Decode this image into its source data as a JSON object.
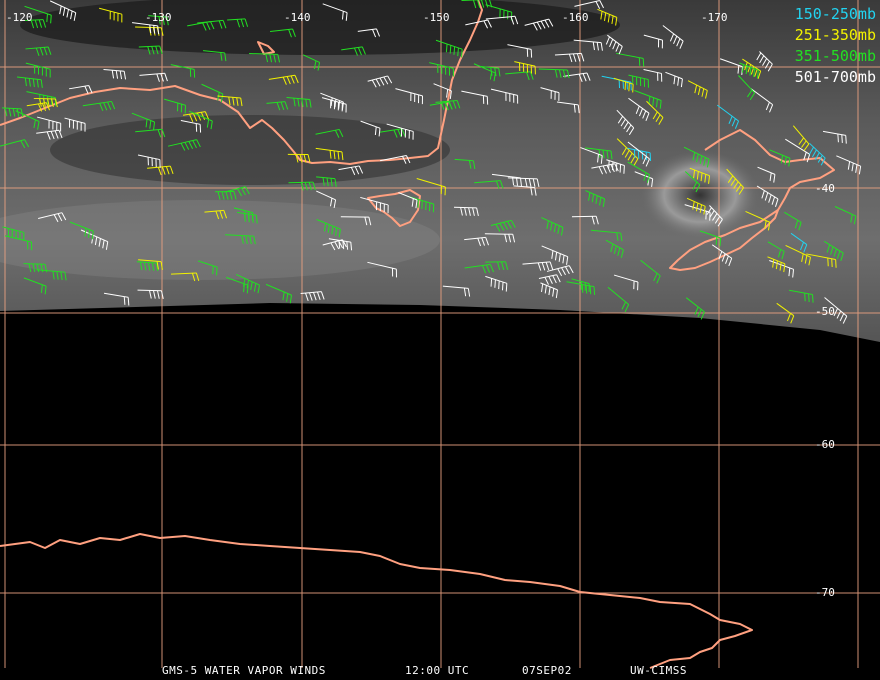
{
  "legend": [
    {
      "label": "150-250mb",
      "color": "#22d3f0"
    },
    {
      "label": "251-350mb",
      "color": "#f2f200"
    },
    {
      "label": "351-500mb",
      "color": "#22e022"
    },
    {
      "label": "501-700mb",
      "color": "#ffffff"
    }
  ],
  "longitude_labels": [
    "-120",
    "-130",
    "-140",
    "-150",
    "-160",
    "-170"
  ],
  "latitude_labels": [
    "-40",
    "-50",
    "-60",
    "-70"
  ],
  "footer": {
    "product": "GMS-5 WATER VAPOR WINDS",
    "time": "12:00 UTC",
    "date": "07SEP02",
    "credit": "UW-CIMSS"
  },
  "colors": {
    "grid": "#e8a080",
    "coastline": "#ffa080",
    "background": "#000000"
  }
}
